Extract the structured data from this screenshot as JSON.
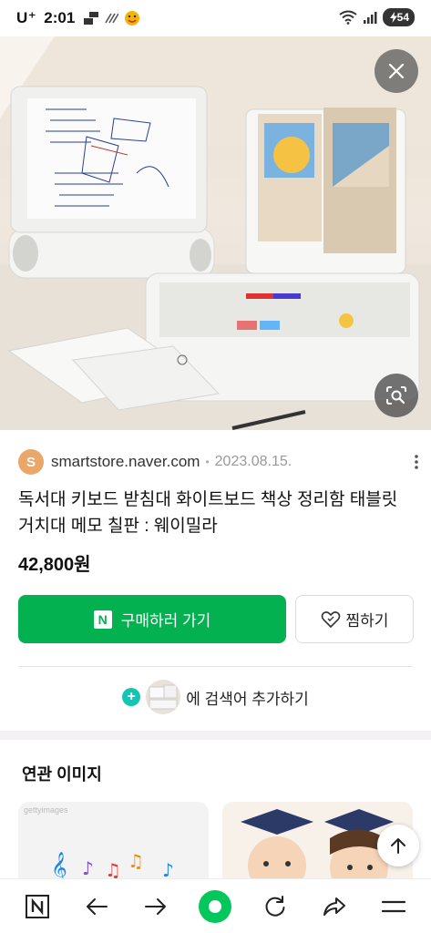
{
  "status_bar": {
    "carrier": "U⁺",
    "time": "2:01",
    "battery": "54"
  },
  "source": {
    "avatar_letter": "S",
    "domain": "smartstore.naver.com",
    "separator": "•",
    "date": "2023.08.15."
  },
  "product": {
    "title": "독서대 키보드 받침대 화이트보드 책상 정리함 태블릿 거치대 메모 칠판 : 웨이밀라",
    "price": "42,800원"
  },
  "actions": {
    "buy_label": "구매하러 가기",
    "buy_logo": "N",
    "save_label": "찜하기",
    "add_keyword_label": "에 검색어 추가하기"
  },
  "related": {
    "title": "연관 이미지",
    "card1_watermark": "gettyimages"
  },
  "bottom_nav": {
    "items": [
      "naver-home",
      "back",
      "forward",
      "green-home",
      "refresh",
      "share",
      "menu"
    ]
  },
  "colors": {
    "accent_green": "#03b150",
    "plus_teal": "#14c5b4",
    "avatar_orange": "#e9a86a"
  }
}
